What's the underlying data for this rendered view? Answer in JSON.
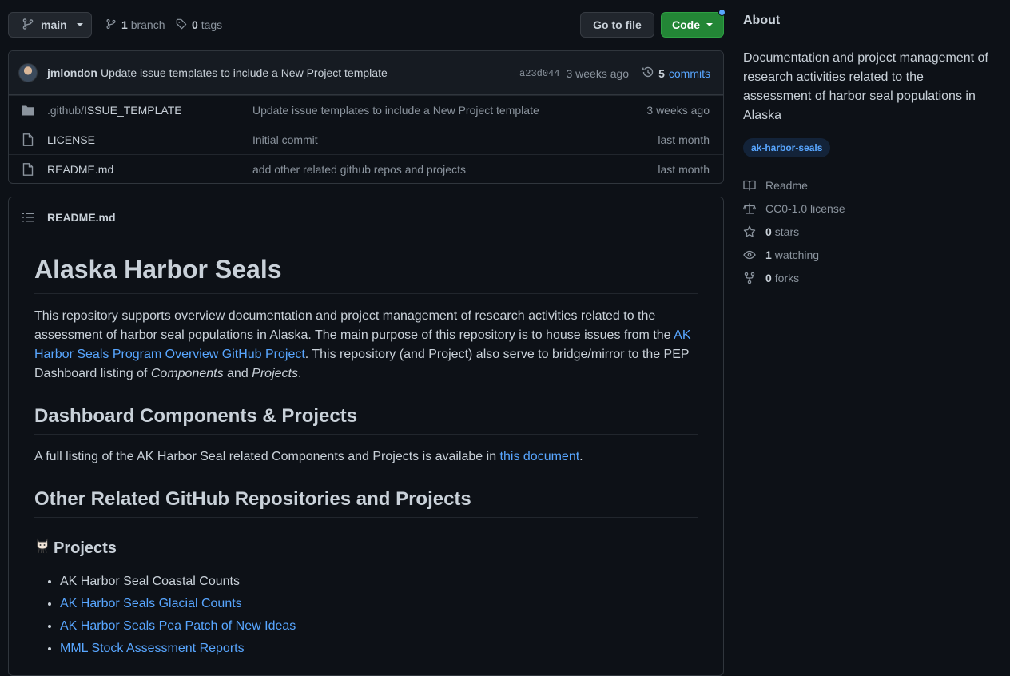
{
  "topbar": {
    "branch": "main",
    "branches_count": "1",
    "branches_label": "branch",
    "tags_count": "0",
    "tags_label": "tags",
    "goto_file": "Go to file",
    "code": "Code"
  },
  "commit": {
    "author": "jmlondon",
    "message": "Update issue templates to include a New Project template",
    "sha": "a23d044",
    "age": "3 weeks ago",
    "commits_count": "5",
    "commits_label": "commits"
  },
  "files": [
    {
      "type": "folder",
      "dir_prefix": ".github/",
      "name": "ISSUE_TEMPLATE",
      "message": "Update issue templates to include a New Project template",
      "age": "3 weeks ago"
    },
    {
      "type": "file",
      "dir_prefix": "",
      "name": "LICENSE",
      "message": "Initial commit",
      "age": "last month"
    },
    {
      "type": "file",
      "dir_prefix": "",
      "name": "README.md",
      "message": "add other related github repos and projects",
      "age": "last month"
    }
  ],
  "readme": {
    "filename": "README.md",
    "h1": "Alaska Harbor Seals",
    "p1_a": "This repository supports overview documentation and project management of research activities related to the assessment of harbor seal populations in Alaska. The main purpose of this repository is to house issues from the ",
    "p1_link": "AK Harbor Seals Program Overview GitHub Project",
    "p1_b": ". This repository (and Project) also serve to bridge/mirror to the PEP Dashboard listing of ",
    "p1_em1": "Components",
    "p1_c": " and ",
    "p1_em2": "Projects",
    "p1_d": ".",
    "h2_dashboard": "Dashboard Components & Projects",
    "p2_a": "A full listing of the AK Harbor Seal related Components and Projects is availabe in ",
    "p2_link": "this document",
    "p2_b": ".",
    "h2_other": "Other Related GitHub Repositories and Projects",
    "h3_projects": "Projects",
    "projects": [
      {
        "label": "AK Harbor Seal Coastal Counts",
        "link": false
      },
      {
        "label": "AK Harbor Seals Glacial Counts",
        "link": true
      },
      {
        "label": "AK Harbor Seals Pea Patch of New Ideas",
        "link": true
      },
      {
        "label": "MML Stock Assessment Reports",
        "link": true
      }
    ]
  },
  "about": {
    "heading": "About",
    "description": "Documentation and project management of research activities related to the assessment of harbor seal populations in Alaska",
    "topic": "ak-harbor-seals",
    "readme": "Readme",
    "license": "CC0-1.0 license",
    "stars_count": "0",
    "stars_label": "stars",
    "watching_count": "1",
    "watching_label": "watching",
    "forks_count": "0",
    "forks_label": "forks"
  },
  "colors": {
    "background": "#0d1117",
    "border": "#30363d",
    "link": "#58a6ff",
    "primary_button": "#238636"
  }
}
